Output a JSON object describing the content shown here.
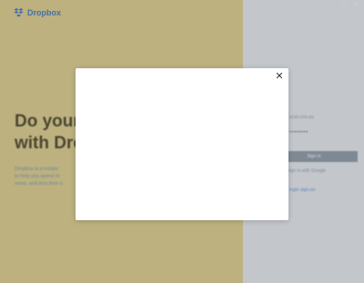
{
  "window": {
    "controls": [
      "−",
      "□",
      "✕"
    ]
  },
  "header": {
    "brand_name": "Dropbox",
    "brand_icon": "dropbox-logo-icon"
  },
  "left": {
    "headline": "Do your\nwith Dro",
    "description": "Dropbox is a moder\nto help you spend m\nnews, and less time s"
  },
  "form": {
    "email_display": "ocal.com.au",
    "password_dots": "••••••••",
    "signin_label": "Sign in",
    "google_label": "Sign in with Google",
    "sso_label": "ingle sign-on"
  },
  "modal": {
    "close_label": "✕"
  },
  "colors": {
    "left_bg": "#bcb17f",
    "right_bg": "#c3c7cb",
    "brand_blue": "#456faa",
    "modal_bg": "#ffffff"
  }
}
